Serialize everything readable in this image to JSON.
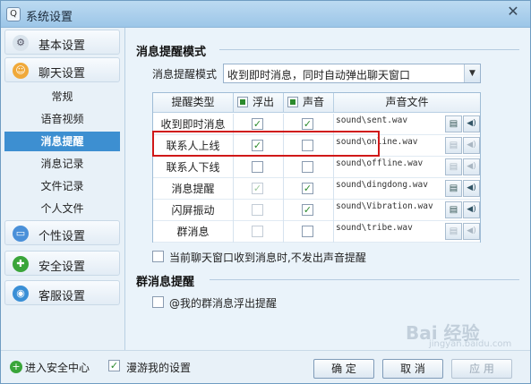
{
  "window": {
    "title": "系统设置",
    "app_icon": "qq-icon",
    "close_glyph": "✕"
  },
  "sidebar": {
    "categories": [
      {
        "label": "基本设置",
        "icon": "gear-icon"
      },
      {
        "label": "聊天设置",
        "icon": "chat-icon"
      },
      {
        "label": "个性设置",
        "icon": "monitor-icon"
      },
      {
        "label": "安全设置",
        "icon": "shield-icon"
      },
      {
        "label": "客服设置",
        "icon": "globe-icon"
      }
    ],
    "sub_items": [
      "常规",
      "语音视频",
      "消息提醒",
      "消息记录",
      "文件记录",
      "个人文件"
    ],
    "active_sub_item": "消息提醒"
  },
  "main": {
    "section1_title": "消息提醒模式",
    "mode_label": "消息提醒模式",
    "mode_value": "收到即时消息，同时自动弹出聊天窗口",
    "table": {
      "headers": {
        "type": "提醒类型",
        "popup": "浮出",
        "sound": "声音",
        "file": "声音文件"
      },
      "rows": [
        {
          "type": "收到即时消息",
          "popup": true,
          "popup_disabled": false,
          "sound": true,
          "file": "sound\\sent.wav"
        },
        {
          "type": "联系人上线",
          "popup": true,
          "popup_disabled": false,
          "sound": false,
          "file": "sound\\online.wav"
        },
        {
          "type": "联系人下线",
          "popup": false,
          "popup_disabled": false,
          "sound": false,
          "file": "sound\\offline.wav"
        },
        {
          "type": "消息提醒",
          "popup": true,
          "popup_disabled": true,
          "sound": true,
          "file": "sound\\dingdong.wav"
        },
        {
          "type": "闪屏振动",
          "popup": false,
          "popup_disabled": true,
          "sound": true,
          "file": "sound\\Vibration.wav"
        },
        {
          "type": "群消息",
          "popup": false,
          "popup_disabled": true,
          "sound": false,
          "file": "sound\\tribe.wav"
        }
      ]
    },
    "no_sound_option": {
      "label": "当前聊天窗口收到消息时,不发出声音提醒",
      "checked": false
    },
    "section2_title": "群消息提醒",
    "group_option": {
      "label": "@我的群消息浮出提醒",
      "checked": false
    }
  },
  "bottom": {
    "security_center_label": "进入安全中心",
    "roam_label": "漫游我的设置",
    "roam_checked": true,
    "ok_label": "确 定",
    "cancel_label": "取 消",
    "apply_label": "应 用"
  },
  "watermark": {
    "text": "Bai 经验",
    "sub": "jingyan.baidu.com"
  },
  "colors": {
    "accent": "#3d8fd1",
    "highlight": "#d01818",
    "check": "#2c8a2c"
  }
}
